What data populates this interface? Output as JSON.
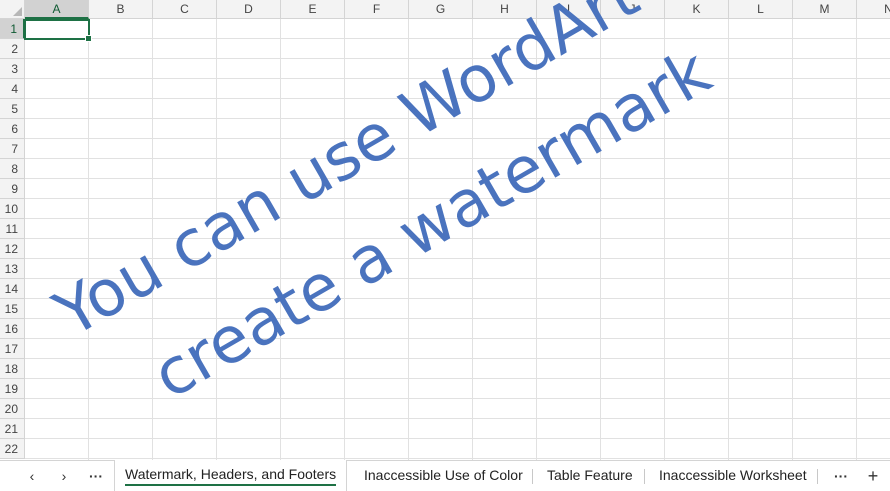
{
  "columns": [
    "A",
    "B",
    "C",
    "D",
    "E",
    "F",
    "G",
    "H",
    "I",
    "J",
    "K",
    "L",
    "M",
    "N"
  ],
  "rows": [
    "1",
    "2",
    "3",
    "4",
    "5",
    "6",
    "7",
    "8",
    "9",
    "10",
    "11",
    "12",
    "13",
    "14",
    "15",
    "16",
    "17",
    "18",
    "19",
    "20",
    "21",
    "22"
  ],
  "active_cell": {
    "column": "A",
    "row": "1"
  },
  "wordart": {
    "line1": "You can use WordArt to",
    "line2": "create a watermark",
    "color": "#4a73be"
  },
  "tabbar": {
    "prev_icon": "‹",
    "next_icon": "›",
    "more_left_icon": "···",
    "more_right_icon": "···",
    "add_icon": "+",
    "tabs": [
      {
        "label": "Watermark, Headers, and Footers",
        "active": true
      },
      {
        "label": "Inaccessible Use of Color",
        "active": false
      },
      {
        "label": "Table Feature",
        "active": false
      },
      {
        "label": "Inaccessible Worksheet",
        "active": false
      }
    ]
  },
  "colors": {
    "accent": "#1e7145",
    "header_bg": "#f3f3f3",
    "gridline": "#e1e1e1"
  }
}
